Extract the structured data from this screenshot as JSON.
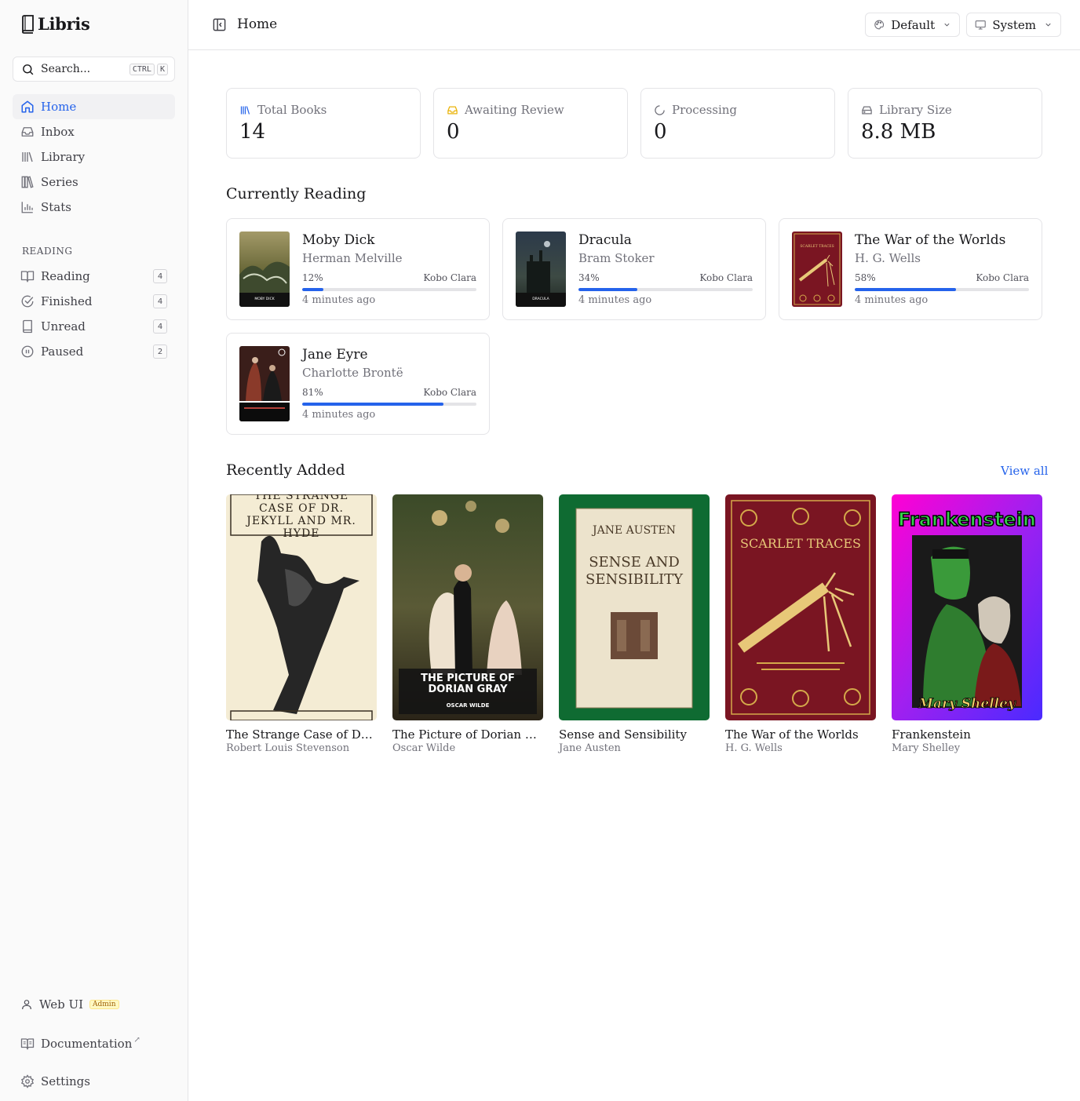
{
  "app": {
    "name": "Libris"
  },
  "search": {
    "placeholder": "Search...",
    "shortcut": [
      "CTRL",
      "K"
    ]
  },
  "nav": [
    {
      "label": "Home",
      "icon": "home-icon",
      "active": true
    },
    {
      "label": "Inbox",
      "icon": "inbox-icon"
    },
    {
      "label": "Library",
      "icon": "library-icon"
    },
    {
      "label": "Series",
      "icon": "series-icon"
    },
    {
      "label": "Stats",
      "icon": "stats-icon"
    }
  ],
  "reading_section": {
    "label": "READING",
    "items": [
      {
        "label": "Reading",
        "icon": "book-open-icon",
        "count": "4"
      },
      {
        "label": "Finished",
        "icon": "check-circle-icon",
        "count": "4"
      },
      {
        "label": "Unread",
        "icon": "book-icon",
        "count": "4"
      },
      {
        "label": "Paused",
        "icon": "pause-circle-icon",
        "count": "2"
      }
    ]
  },
  "footer": {
    "web_ui": "Web UI",
    "admin_badge": "Admin",
    "documentation": "Documentation",
    "external_mark": "↗",
    "settings": "Settings"
  },
  "header": {
    "title": "Home",
    "theme_dropdown": "Default",
    "mode_dropdown": "System"
  },
  "stats": [
    {
      "label": "Total Books",
      "value": "14",
      "icon": "library-icon",
      "color": "#2563eb"
    },
    {
      "label": "Awaiting Review",
      "value": "0",
      "icon": "inbox-icon",
      "color": "#eab308"
    },
    {
      "label": "Processing",
      "value": "0",
      "icon": "loader-icon",
      "color": "#71717a"
    },
    {
      "label": "Library Size",
      "value": "8.8 MB",
      "icon": "hard-drive-icon",
      "color": "#71717a"
    }
  ],
  "currently_reading": {
    "title": "Currently Reading",
    "books": [
      {
        "title": "Moby Dick",
        "author": "Herman Melville",
        "progress_label": "12%",
        "progress": 12,
        "device": "Kobo Clara",
        "updated": "4 minutes ago",
        "cover_text": "MOBY DICK"
      },
      {
        "title": "Dracula",
        "author": "Bram Stoker",
        "progress_label": "34%",
        "progress": 34,
        "device": "Kobo Clara",
        "updated": "4 minutes ago",
        "cover_text": "DRACULA"
      },
      {
        "title": "The War of the Worlds",
        "author": "H. G. Wells",
        "progress_label": "58%",
        "progress": 58,
        "device": "Kobo Clara",
        "updated": "4 minutes ago",
        "cover_text": "SCARLET TRACES"
      },
      {
        "title": "Jane Eyre",
        "author": "Charlotte Brontë",
        "progress_label": "81%",
        "progress": 81,
        "device": "Kobo Clara",
        "updated": "4 minutes ago",
        "cover_text": ""
      }
    ]
  },
  "recently_added": {
    "title": "Recently Added",
    "view_all": "View all",
    "books": [
      {
        "title": "The Strange Case of Dr. Jek...",
        "author": "Robert Louis Stevenson",
        "cover_text": "THE STRANGE CASE OF DR. JEKYLL AND MR. HYDE"
      },
      {
        "title": "The Picture of Dorian Gray",
        "author": "Oscar Wilde",
        "cover_text": "THE PICTURE OF DORIAN GRAY",
        "cover_subtext": "OSCAR WILDE"
      },
      {
        "title": "Sense and Sensibility",
        "author": "Jane Austen",
        "cover_text": "SENSE AND SENSIBILITY",
        "cover_subtext": "JANE AUSTEN"
      },
      {
        "title": "The War of the Worlds",
        "author": "H. G. Wells",
        "cover_text": "SCARLET TRACES"
      },
      {
        "title": "Frankenstein",
        "author": "Mary Shelley",
        "cover_text": "Frankenstein",
        "cover_subtext": "Mary Shelley"
      }
    ]
  }
}
